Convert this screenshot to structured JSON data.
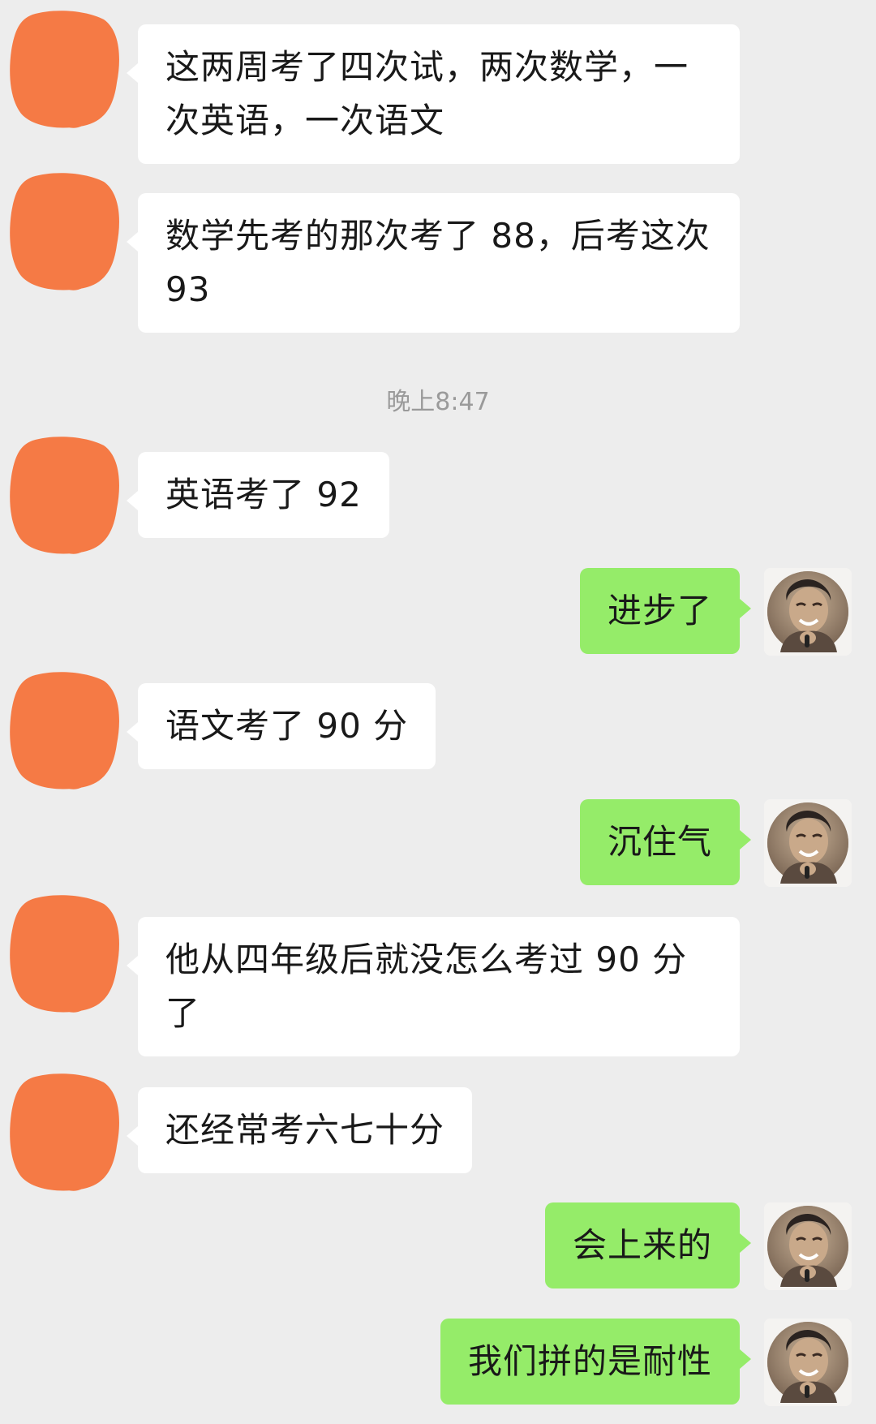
{
  "chat": {
    "timestamp": "晚上8:47",
    "messages": [
      {
        "side": "in",
        "text": "这两周考了四次试，两次数学，一次英语，一次语文"
      },
      {
        "side": "in",
        "text": "数学先考的那次考了 88，后考这次 93"
      },
      {
        "side": "in",
        "text": "英语考了 92"
      },
      {
        "side": "out",
        "text": "进步了"
      },
      {
        "side": "in",
        "text": "语文考了 90 分"
      },
      {
        "side": "out",
        "text": "沉住气"
      },
      {
        "side": "in",
        "text": "他从四年级后就没怎么考过 90 分了"
      },
      {
        "side": "in",
        "text": "还经常考六七十分"
      },
      {
        "side": "out",
        "text": "会上来的"
      },
      {
        "side": "out",
        "text": "我们拼的是耐性"
      }
    ]
  },
  "colors": {
    "background": "#ededed",
    "incoming_bubble": "#ffffff",
    "outgoing_bubble": "#95ec69",
    "redaction": "#f57a45"
  },
  "icons": {
    "incoming_avatar": "redacted-avatar-icon",
    "outgoing_avatar": "user-photo-avatar"
  }
}
